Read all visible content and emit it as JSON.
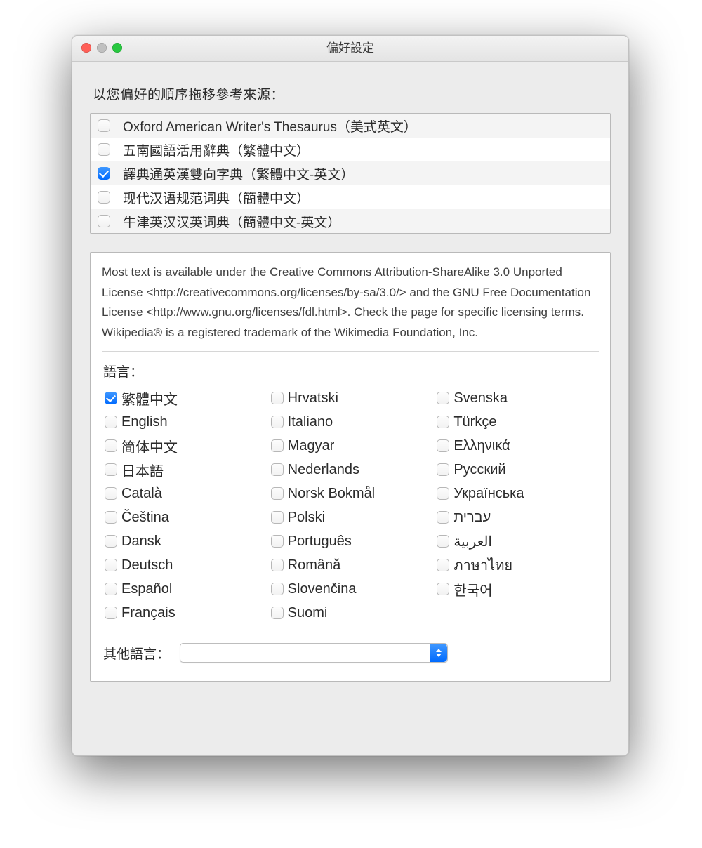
{
  "window": {
    "title": "偏好設定"
  },
  "instruction": "以您偏好的順序拖移參考來源：",
  "sources": [
    {
      "label": "Oxford American Writer's Thesaurus（美式英文）",
      "checked": false
    },
    {
      "label": "五南國語活用辭典（繁體中文）",
      "checked": false
    },
    {
      "label": "譯典通英漢雙向字典（繁體中文-英文）",
      "checked": true
    },
    {
      "label": "现代汉语规范词典（簡體中文）",
      "checked": false
    },
    {
      "label": "牛津英汉汉英词典（簡體中文-英文）",
      "checked": false
    }
  ],
  "license_text": "Most text is available under the Creative Commons Attribution-ShareAlike 3.0 Unported License <http://creativecommons.org/licenses/by-sa/3.0/> and the GNU Free Documentation License <http://www.gnu.org/licenses/fdl.html>. Check the page for specific licensing terms. Wikipedia® is a registered trademark of the Wikimedia Foundation, Inc.",
  "languages_heading": "語言：",
  "languages": [
    {
      "label": "繁體中文",
      "checked": true
    },
    {
      "label": "Hrvatski",
      "checked": false
    },
    {
      "label": "Svenska",
      "checked": false
    },
    {
      "label": "English",
      "checked": false
    },
    {
      "label": "Italiano",
      "checked": false
    },
    {
      "label": "Türkçe",
      "checked": false
    },
    {
      "label": "简体中文",
      "checked": false
    },
    {
      "label": "Magyar",
      "checked": false
    },
    {
      "label": "Ελληνικά",
      "checked": false
    },
    {
      "label": "日本語",
      "checked": false
    },
    {
      "label": "Nederlands",
      "checked": false
    },
    {
      "label": "Русский",
      "checked": false
    },
    {
      "label": "Català",
      "checked": false
    },
    {
      "label": "Norsk Bokmål",
      "checked": false
    },
    {
      "label": "Українська",
      "checked": false
    },
    {
      "label": "Čeština",
      "checked": false
    },
    {
      "label": "Polski",
      "checked": false
    },
    {
      "label": "עברית",
      "checked": false
    },
    {
      "label": "Dansk",
      "checked": false
    },
    {
      "label": "Português",
      "checked": false
    },
    {
      "label": "العربية",
      "checked": false
    },
    {
      "label": "Deutsch",
      "checked": false
    },
    {
      "label": "Română",
      "checked": false
    },
    {
      "label": "ภาษาไทย",
      "checked": false
    },
    {
      "label": "Español",
      "checked": false
    },
    {
      "label": "Slovenčina",
      "checked": false
    },
    {
      "label": "한국어",
      "checked": false
    },
    {
      "label": "Français",
      "checked": false
    },
    {
      "label": "Suomi",
      "checked": false
    }
  ],
  "other_label": "其他語言：",
  "other_value": ""
}
